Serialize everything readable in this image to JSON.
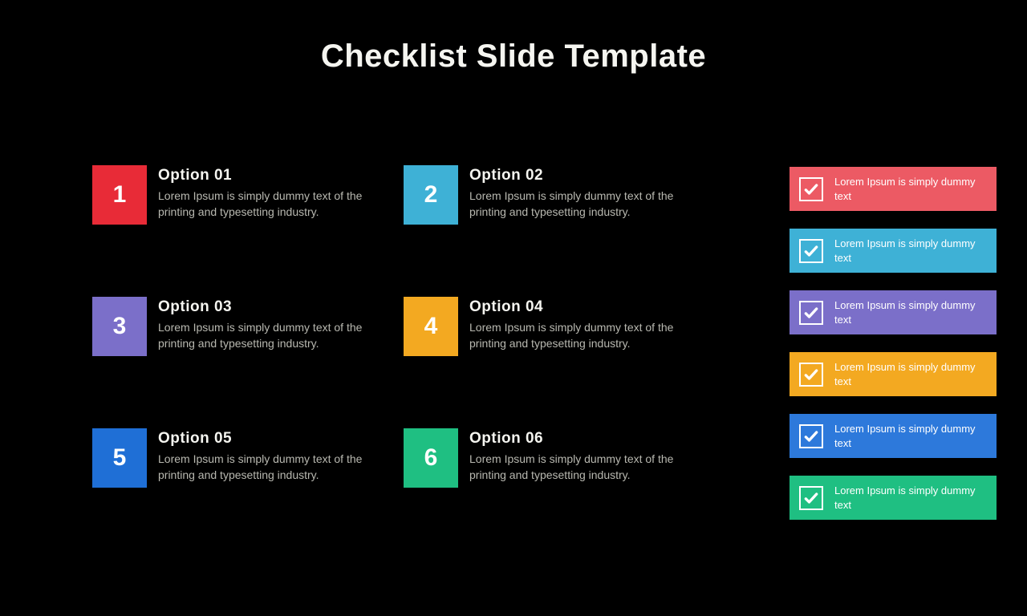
{
  "title": "Checklist Slide Template",
  "options": [
    {
      "num": "1",
      "title": "Option 01",
      "desc": "Lorem Ipsum is simply dummy text of the printing and typesetting industry.",
      "color": "#e82b37"
    },
    {
      "num": "2",
      "title": "Option 02",
      "desc": "Lorem Ipsum is simply dummy text of the printing and typesetting industry.",
      "color": "#3eb1d6"
    },
    {
      "num": "3",
      "title": "Option 03",
      "desc": "Lorem Ipsum is simply dummy text of the printing and typesetting industry.",
      "color": "#7b6fc9"
    },
    {
      "num": "4",
      "title": "Option 04",
      "desc": "Lorem Ipsum is simply dummy text of the printing and typesetting industry.",
      "color": "#f3a921"
    },
    {
      "num": "5",
      "title": "Option 05",
      "desc": "Lorem Ipsum is simply dummy text of the printing and typesetting industry.",
      "color": "#1f6fd6"
    },
    {
      "num": "6",
      "title": "Option 06",
      "desc": "Lorem Ipsum is simply dummy text of the printing and typesetting industry.",
      "color": "#1fbf82"
    }
  ],
  "checklist": [
    {
      "text": "Lorem Ipsum is simply dummy text",
      "color": "#ec5a64"
    },
    {
      "text": "Lorem Ipsum is simply dummy text",
      "color": "#3eb1d6"
    },
    {
      "text": "Lorem Ipsum is simply dummy text",
      "color": "#7b6fc9"
    },
    {
      "text": "Lorem Ipsum is simply dummy text",
      "color": "#f3a921"
    },
    {
      "text": "Lorem Ipsum is simply dummy text",
      "color": "#2d79db"
    },
    {
      "text": "Lorem Ipsum is simply dummy text",
      "color": "#1fbf82"
    }
  ]
}
